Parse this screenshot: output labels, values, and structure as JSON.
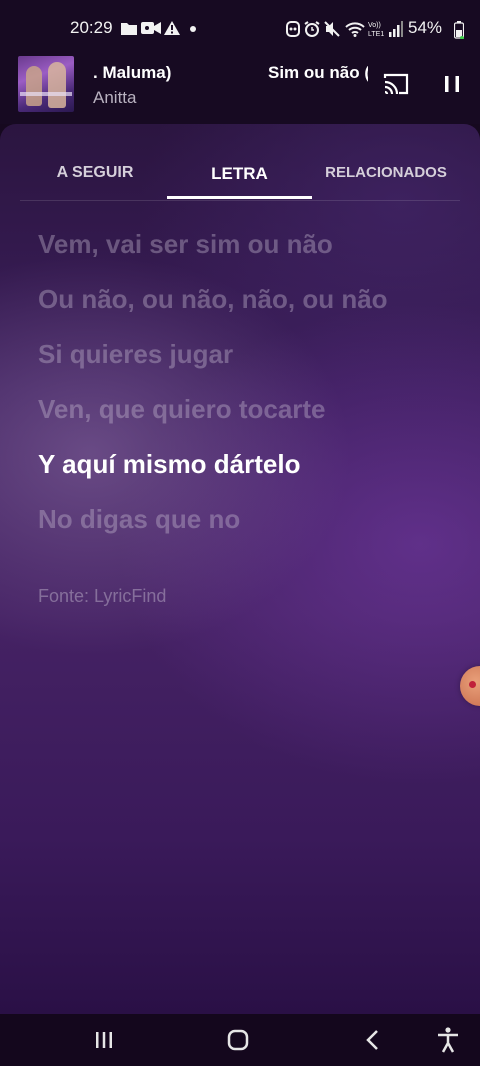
{
  "status_bar": {
    "time": "20:29",
    "battery": "54%",
    "icons": [
      "folder-icon",
      "video-icon",
      "warning-icon",
      "dot-icon",
      "bixby-icon",
      "alarm-icon",
      "mute-icon",
      "wifi-icon",
      "volte-icon",
      "signal-icon",
      "battery-icon"
    ]
  },
  "mini_player": {
    "title_part1": ". Maluma)",
    "title_part2": "Sim ou não (",
    "artist": "Anitta",
    "cast_icon": "cast-icon",
    "pause_icon": "pause-icon"
  },
  "tabs": [
    {
      "label": "A SEGUIR",
      "selected": false
    },
    {
      "label": "LETRA",
      "selected": true
    },
    {
      "label": "RELACIONADOS",
      "selected": false
    }
  ],
  "lyrics": {
    "lines": [
      "Vem, vai ser sim ou não",
      "Ou não, ou não, não, ou não",
      "Si quieres jugar",
      "Ven, que quiero tocarte",
      "Y aquí mismo dártelo",
      "No digas que no"
    ],
    "active_index": 4,
    "source": "Fonte: LyricFind"
  },
  "nav_bar": {
    "icons": [
      "recents-icon",
      "home-icon",
      "back-icon",
      "accessibility-icon"
    ]
  }
}
